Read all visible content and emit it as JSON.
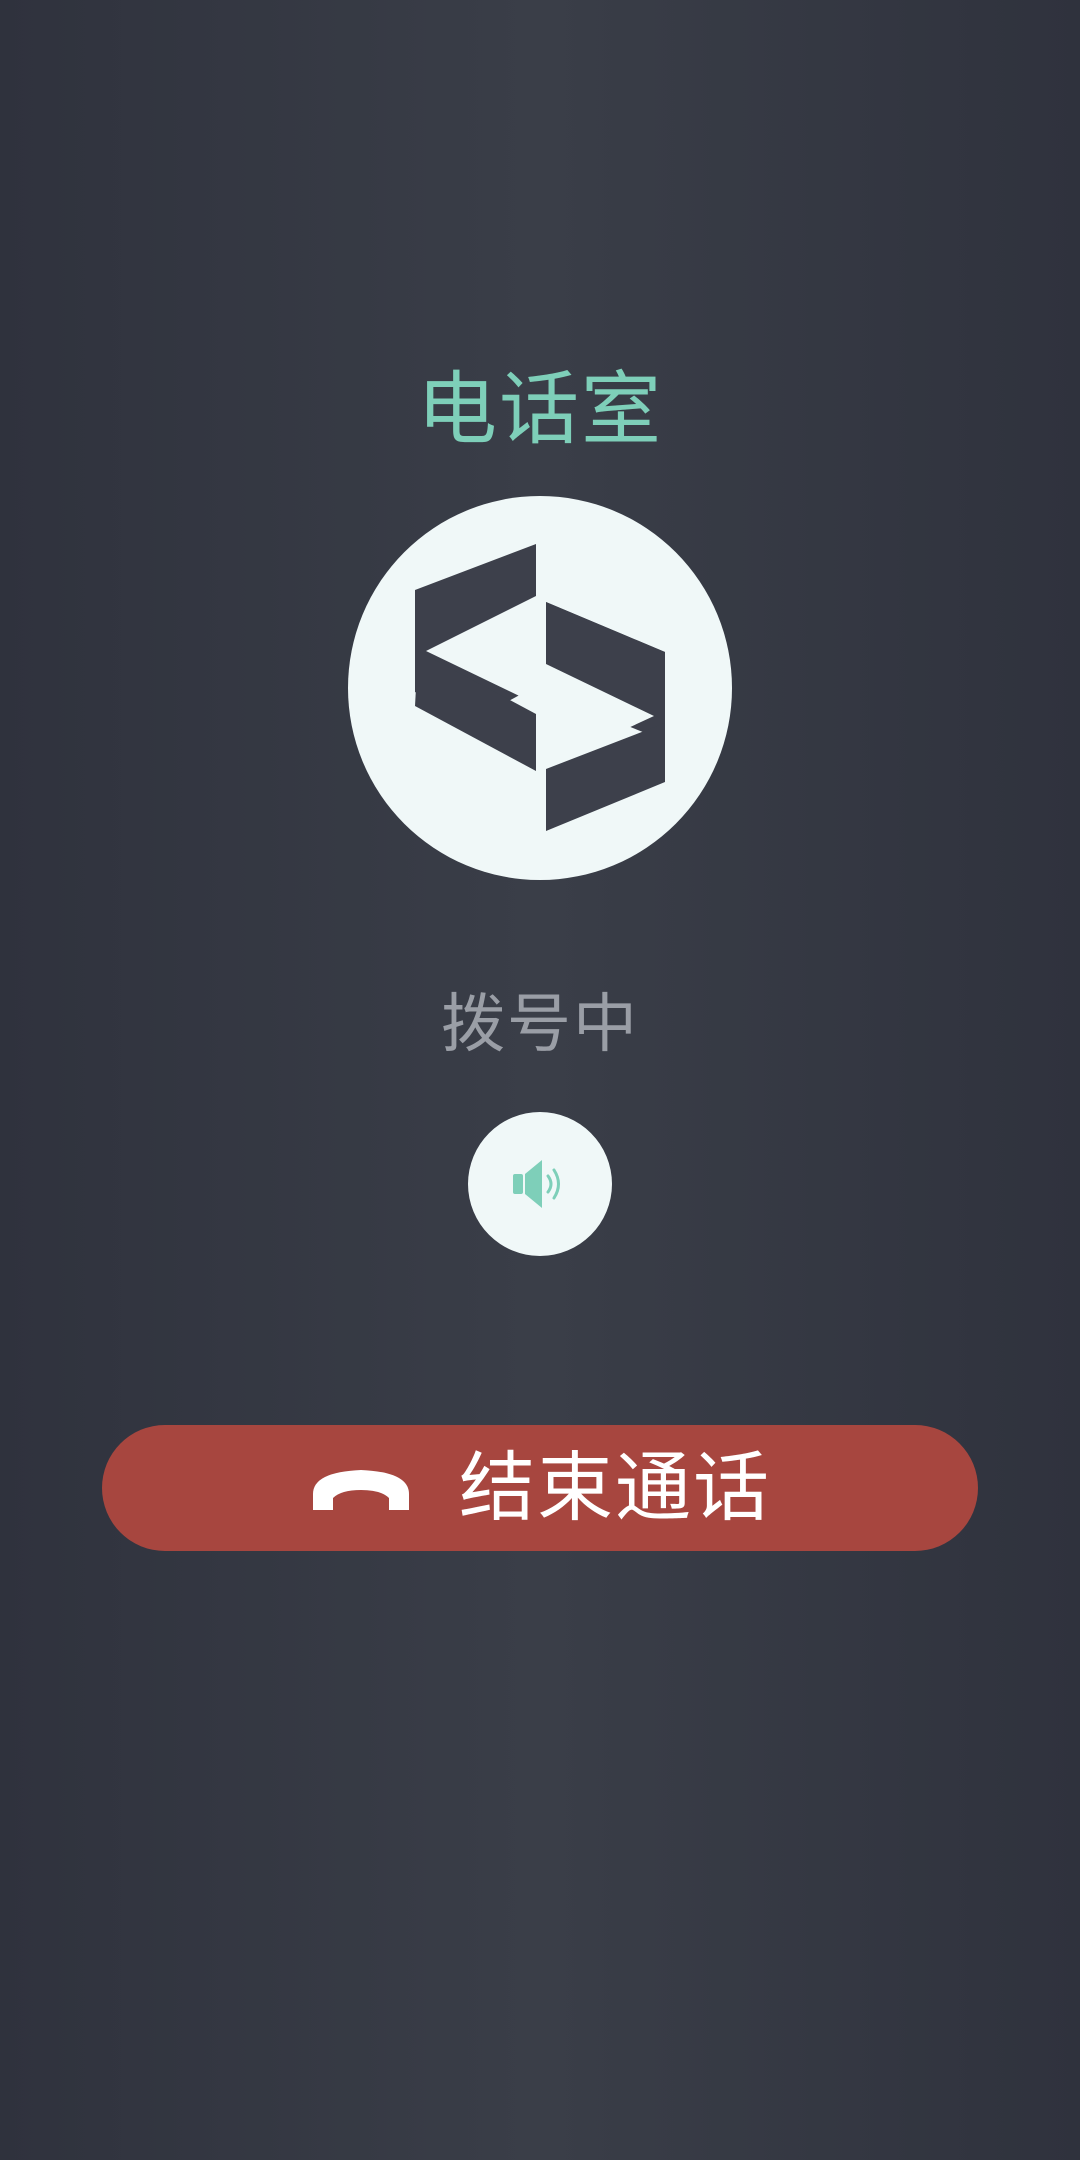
{
  "call": {
    "title": "电话室",
    "status": "拨号中",
    "end_label": "结束通话"
  },
  "icons": {
    "avatar": "room-logo-icon",
    "speaker": "speaker-icon",
    "hangup": "phone-hangup-icon"
  },
  "colors": {
    "title": "#7ecfb9",
    "status": "#9a9ea6",
    "end_button": "#a7463f",
    "circle": "#f0f8f8",
    "logo": "#3d404b",
    "accent": "#7ecfb9"
  }
}
